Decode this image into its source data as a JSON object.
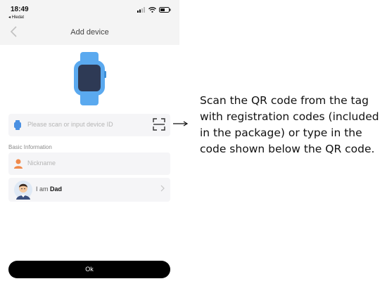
{
  "status_bar": {
    "time": "18:49",
    "back_app": "◂ Hledat",
    "icons": [
      "signal-icon",
      "wifi-icon",
      "battery-icon"
    ]
  },
  "nav": {
    "title": "Add device",
    "back_icon": "chevron-left-icon"
  },
  "device": {
    "image": "smartwatch-icon",
    "watch_color": "#5aa9ef",
    "screen_color": "#2e3a55"
  },
  "form": {
    "device_id_placeholder": "Please scan or input device ID",
    "section_label": "Basic Information",
    "nickname_placeholder": "Nickname",
    "relation_prefix": "I am",
    "relation_value": "Dad"
  },
  "ok_label": "Ok",
  "callout": {
    "text": "Scan the QR code from the tag with registration codes (included in the package) or type in the code shown below the QR code."
  },
  "colors": {
    "accent_blue": "#4a90e2",
    "person_orange": "#f08a4b",
    "button_black": "#000000"
  }
}
